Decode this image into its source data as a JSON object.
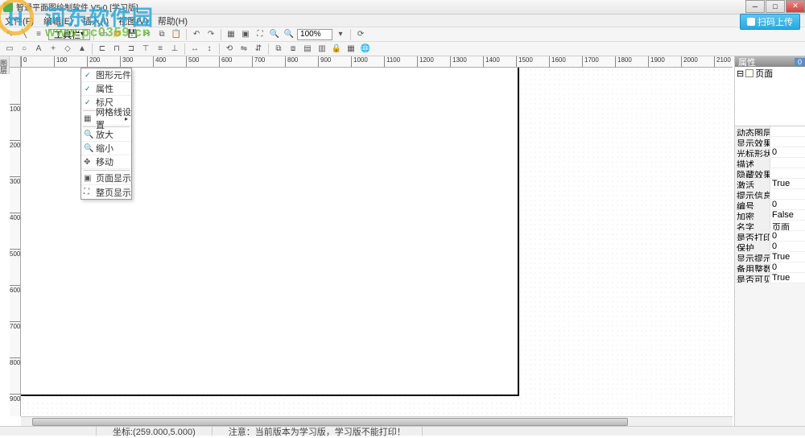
{
  "window": {
    "title": "智通平面图绘制软件 V5.0 [学习版]"
  },
  "menubar": {
    "items": [
      "文件(F)",
      "编辑(E)",
      "插入(I)",
      "视图(V)",
      "帮助(H)"
    ],
    "upload_label": "扫码上传"
  },
  "toolbar1": {
    "label": "工具栏",
    "zoom": "100%"
  },
  "ruler_h": [
    0,
    100,
    200,
    300,
    400,
    500,
    600,
    700,
    800,
    900,
    1000,
    1100,
    1200,
    1300,
    1400,
    1500,
    1600,
    1700,
    1800,
    1900,
    2000,
    2100
  ],
  "ruler_v": [
    100,
    200,
    300,
    400,
    500,
    600,
    700,
    800,
    900
  ],
  "context_menu": {
    "items": [
      {
        "label": "图形元件",
        "checked": true
      },
      {
        "label": "属性",
        "checked": true
      },
      {
        "label": "标尺",
        "checked": true
      },
      {
        "label": "网格线设置",
        "submenu": true
      },
      {
        "label": "放大",
        "icon": "zoom-in"
      },
      {
        "label": "缩小",
        "icon": "zoom-out"
      },
      {
        "label": "移动",
        "icon": "move"
      },
      {
        "label": "页面显示",
        "icon": "page"
      },
      {
        "label": "整页显示",
        "icon": "full"
      }
    ]
  },
  "right_panel": {
    "header": "属性",
    "tree_root": "页面",
    "count": "0",
    "props": [
      {
        "name": "动态图层",
        "val": ""
      },
      {
        "name": "显示效果",
        "val": ""
      },
      {
        "name": "光标形状",
        "val": "0"
      },
      {
        "name": "描述",
        "val": ""
      },
      {
        "name": "隐藏效果",
        "val": ""
      },
      {
        "name": "激活",
        "val": "True"
      },
      {
        "name": "提示信息",
        "val": ""
      },
      {
        "name": "编号",
        "val": "0"
      },
      {
        "name": "加密",
        "val": "False"
      },
      {
        "name": "名字",
        "val": "页面"
      },
      {
        "name": "是否打印",
        "val": "0"
      },
      {
        "name": "保护",
        "val": "0"
      },
      {
        "name": "显示提示",
        "val": "True"
      },
      {
        "name": "备用整数",
        "val": "0"
      },
      {
        "name": "是否可见",
        "val": "True"
      }
    ]
  },
  "statusbar": {
    "coords": "坐标:(259.000,5.000)",
    "notice": "注意：当前版本为学习版，学习版不能打印！"
  },
  "left_tab": {
    "label": "图层"
  },
  "watermark": {
    "text": "河东软件园",
    "url": "www.pc0359.cn"
  }
}
